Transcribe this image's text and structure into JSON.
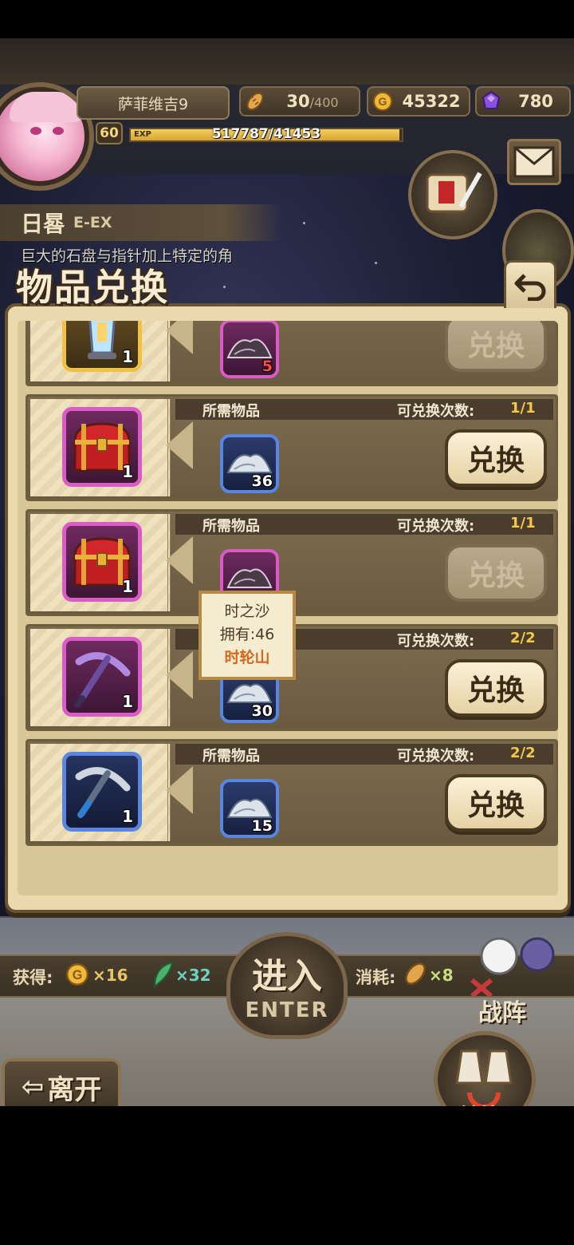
{
  "player": {
    "name": "萨菲维吉9",
    "level": "60",
    "exp_tag": "EXP",
    "exp_text": "517787/41453",
    "exp_progress": 0.99
  },
  "resources": {
    "stamina": {
      "value": "30",
      "max": "/400",
      "icon": "bread-icon"
    },
    "gold": {
      "value": "45322",
      "icon": "gold-coin-icon"
    },
    "gem": {
      "value": "780",
      "icon": "purple-gem-icon"
    }
  },
  "stage": {
    "name": "日晷",
    "difficulty": "E-EX",
    "description": "巨大的石盘与指针加上特定的角"
  },
  "exchange_panel": {
    "title": "物品兑换",
    "need_label": "所需物品",
    "count_label": "可兑换次数:",
    "button_label": "兑换",
    "rows": [
      {
        "reward": "lantern",
        "reward_count": "1",
        "reward_rarity": "gold",
        "material": "dark-sand",
        "material_rarity": "purple",
        "material_count": "5",
        "material_short": true,
        "exchanges": "",
        "enabled": false
      },
      {
        "reward": "treasure-chest",
        "reward_count": "1",
        "reward_rarity": "purple",
        "material": "silver-sand",
        "material_rarity": "blue",
        "material_count": "36",
        "material_short": false,
        "exchanges": "1/1",
        "enabled": true
      },
      {
        "reward": "treasure-chest",
        "reward_count": "1",
        "reward_rarity": "purple",
        "material": "dark-sand",
        "material_rarity": "purple",
        "material_count": "",
        "material_short": false,
        "exchanges": "1/1",
        "enabled": false
      },
      {
        "reward": "purple-pickaxe",
        "reward_count": "1",
        "reward_rarity": "purple",
        "material": "silver-sand",
        "material_rarity": "blue",
        "material_count": "30",
        "material_short": false,
        "exchanges": "2/2",
        "enabled": true
      },
      {
        "reward": "blue-pickaxe",
        "reward_count": "1",
        "reward_rarity": "blue",
        "material": "silver-sand",
        "material_rarity": "blue",
        "material_count": "15",
        "material_short": false,
        "exchanges": "2/2",
        "enabled": true
      }
    ]
  },
  "tooltip": {
    "item": "时之沙",
    "owned": "拥有:46",
    "source": "时轮山"
  },
  "bottom_bar": {
    "gain_label": "获得:",
    "gain_gold": "×16",
    "gain_feather": "×32",
    "cost_label": "消耗:",
    "cost_bread": "×8",
    "enter_cn": "进入",
    "enter_en": "ENTER",
    "formation_label": "战阵",
    "leave_label": "离开",
    "exchange_label": "兑换"
  },
  "colors": {
    "highlight_count": "#f5c84a",
    "tooltip_source": "#d2691e",
    "material_short": "#ff4a4a"
  }
}
